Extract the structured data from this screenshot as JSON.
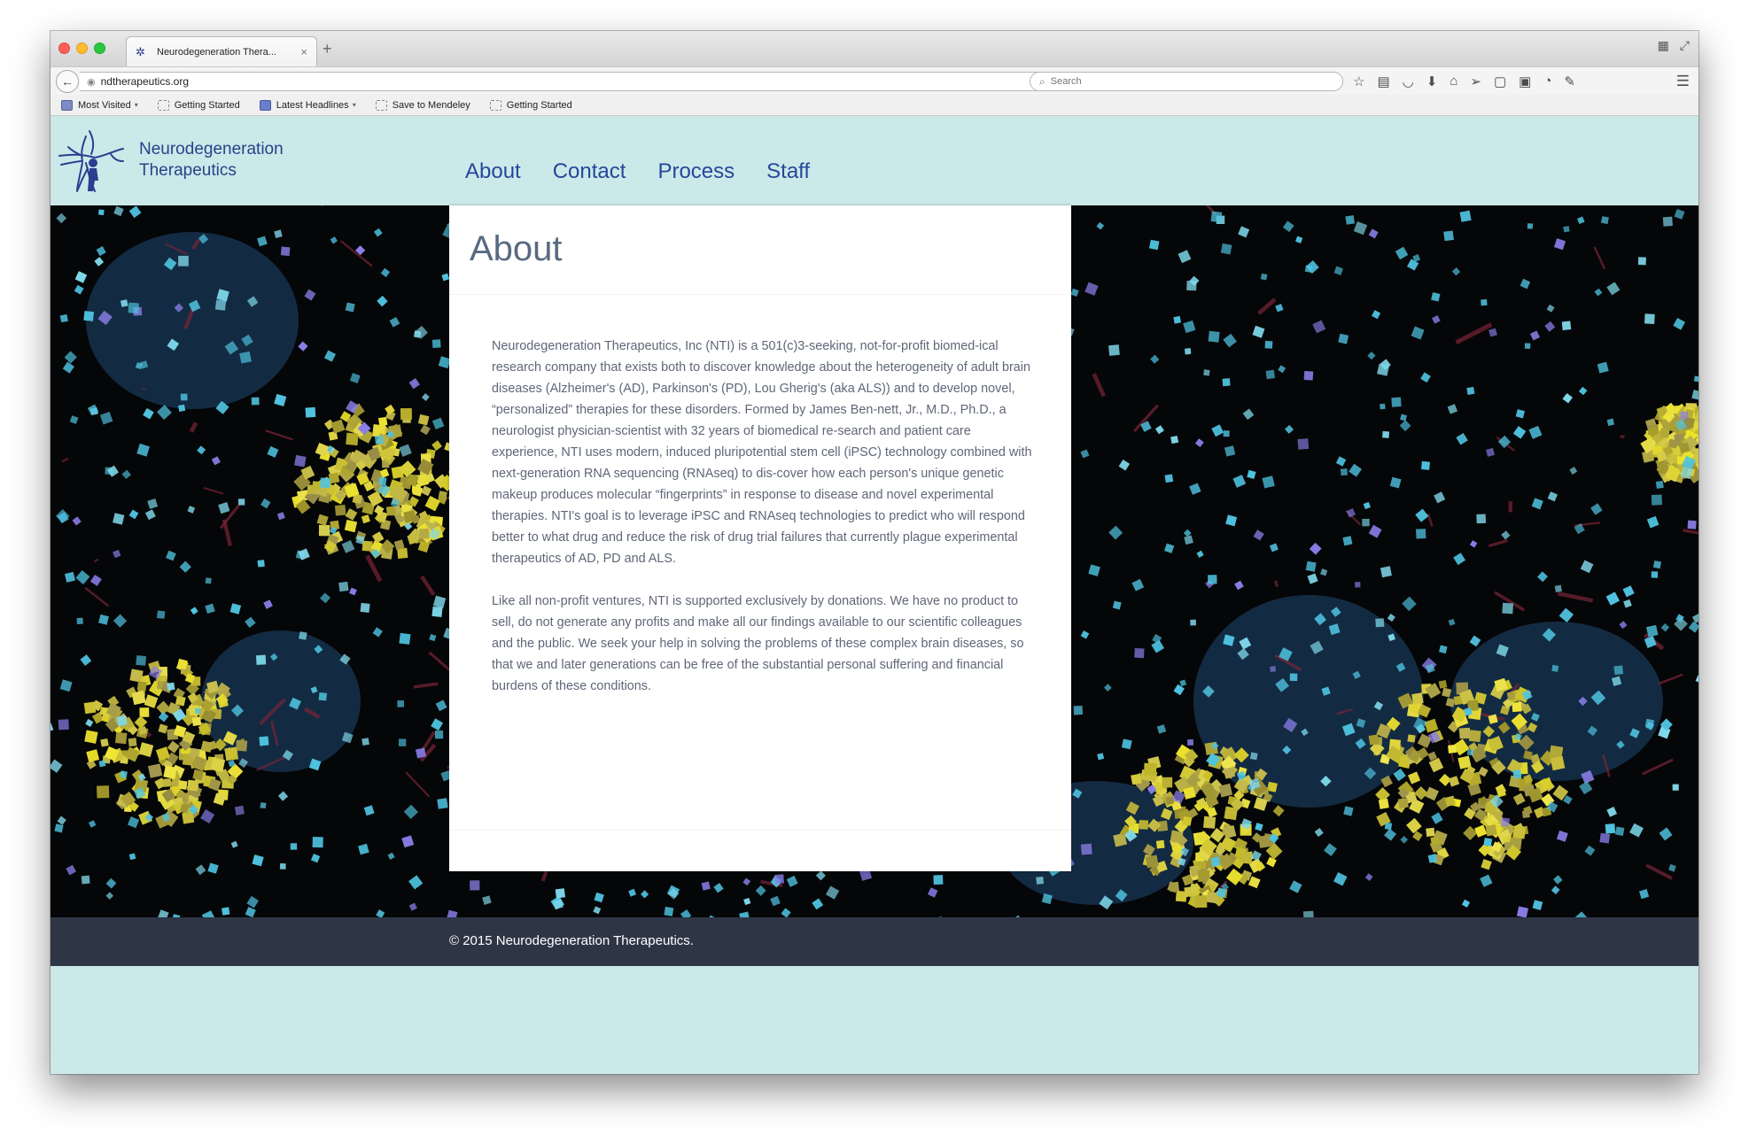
{
  "browser": {
    "tab_title": "Neurodegeneration Thera...",
    "tab_close": "×",
    "new_tab": "+",
    "url": "ndtherapeutics.org",
    "search_placeholder": "Search",
    "bookmarks": [
      {
        "label": "Most Visited",
        "icon": "folder",
        "caret": "▾"
      },
      {
        "label": "Getting Started",
        "icon": "page"
      },
      {
        "label": "Latest Headlines",
        "icon": "rss",
        "caret": "▾"
      },
      {
        "label": "Save to Mendeley",
        "icon": "page"
      },
      {
        "label": "Getting Started",
        "icon": "page"
      }
    ]
  },
  "site": {
    "logo_line1": "Neurodegeneration",
    "logo_line2": "Therapeutics",
    "nav": [
      "About",
      "Contact",
      "Process",
      "Staff"
    ],
    "card": {
      "title": "About",
      "paragraphs": [
        "Neurodegeneration Therapeutics, Inc (NTI) is a 501(c)3-seeking, not-for-profit biomed-ical research company that exists both to discover knowledge about the heterogeneity of adult brain diseases (Alzheimer's (AD), Parkinson's (PD), Lou Gherig's (aka ALS)) and to develop novel, “personalized” therapies for these disorders. Formed by James Ben-nett, Jr., M.D., Ph.D., a neurologist physician-scientist with 32 years of biomedical re-search and patient care experience, NTI uses modern, induced pluripotential stem cell (iPSC) technology combined with next-generation RNA sequencing (RNAseq) to dis-cover how each person's unique genetic makeup produces molecular “fingerprints” in response to disease and novel experimental therapies. NTI's goal is to leverage iPSC and RNAseq technologies to predict who will respond better to what drug and reduce the risk of drug trial failures that currently plague experimental therapeutics of AD, PD and ALS.",
        "Like all non-profit ventures, NTI is supported exclusively by donations. We have no product to sell, do not generate any profits and make all our findings available to our scientific colleagues and the public. We seek your help in solving the problems of these complex brain diseases, so that we and later generations can be free of the substantial personal suffering and financial burdens of these conditions."
      ]
    },
    "footer": "© 2015 Neurodegeneration Therapeutics."
  },
  "colors": {
    "page_bg": "#cbe9e9",
    "nav_link": "#26479a",
    "footer_bg": "#2e3646",
    "hero_bg": "#050608"
  },
  "icons": {
    "back": "back-arrow-icon",
    "reload": "reload-icon",
    "search": "search-icon",
    "menu": "hamburger-menu-icon"
  }
}
